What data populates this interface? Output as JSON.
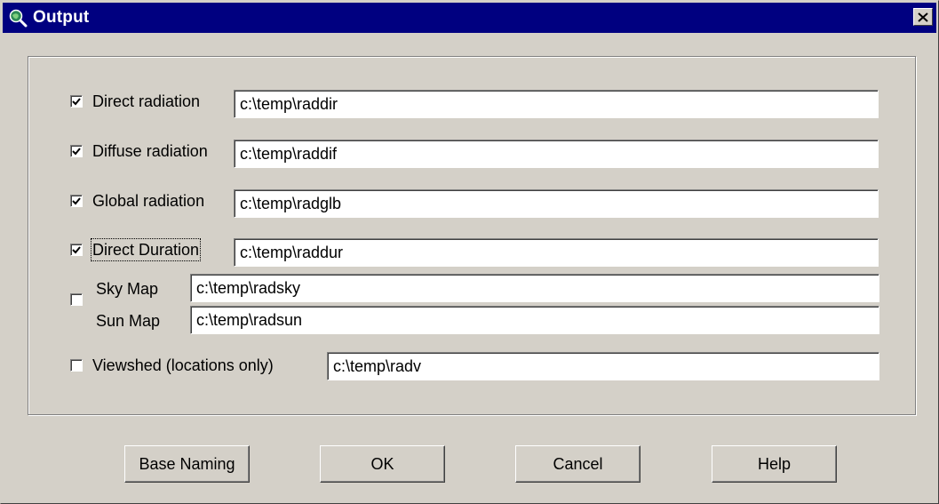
{
  "window": {
    "title": "Output",
    "icon": "magnifier-globe-icon",
    "close_icon": "close-icon",
    "titlebar_color": "#000080",
    "face_color": "#d4d0c8"
  },
  "outputs": [
    {
      "label": "Direct radiation",
      "checked": true,
      "path": "c:\\temp\\raddir"
    },
    {
      "label": "Diffuse radiation",
      "checked": true,
      "path": "c:\\temp\\raddif"
    },
    {
      "label": "Global radiation",
      "checked": true,
      "path": "c:\\temp\\radglb"
    },
    {
      "label": "Direct Duration",
      "checked": true,
      "path": "c:\\temp\\raddur",
      "focused": true
    }
  ],
  "maps": {
    "checked": false,
    "sky_label": "Sky Map",
    "sky_path": "c:\\temp\\radsky",
    "sun_label": "Sun Map",
    "sun_path": "c:\\temp\\radsun"
  },
  "viewshed": {
    "label": "Viewshed (locations only)",
    "checked": false,
    "path": "c:\\temp\\radv"
  },
  "buttons": {
    "base_naming": "Base Naming",
    "ok": "OK",
    "cancel": "Cancel",
    "help": "Help"
  }
}
